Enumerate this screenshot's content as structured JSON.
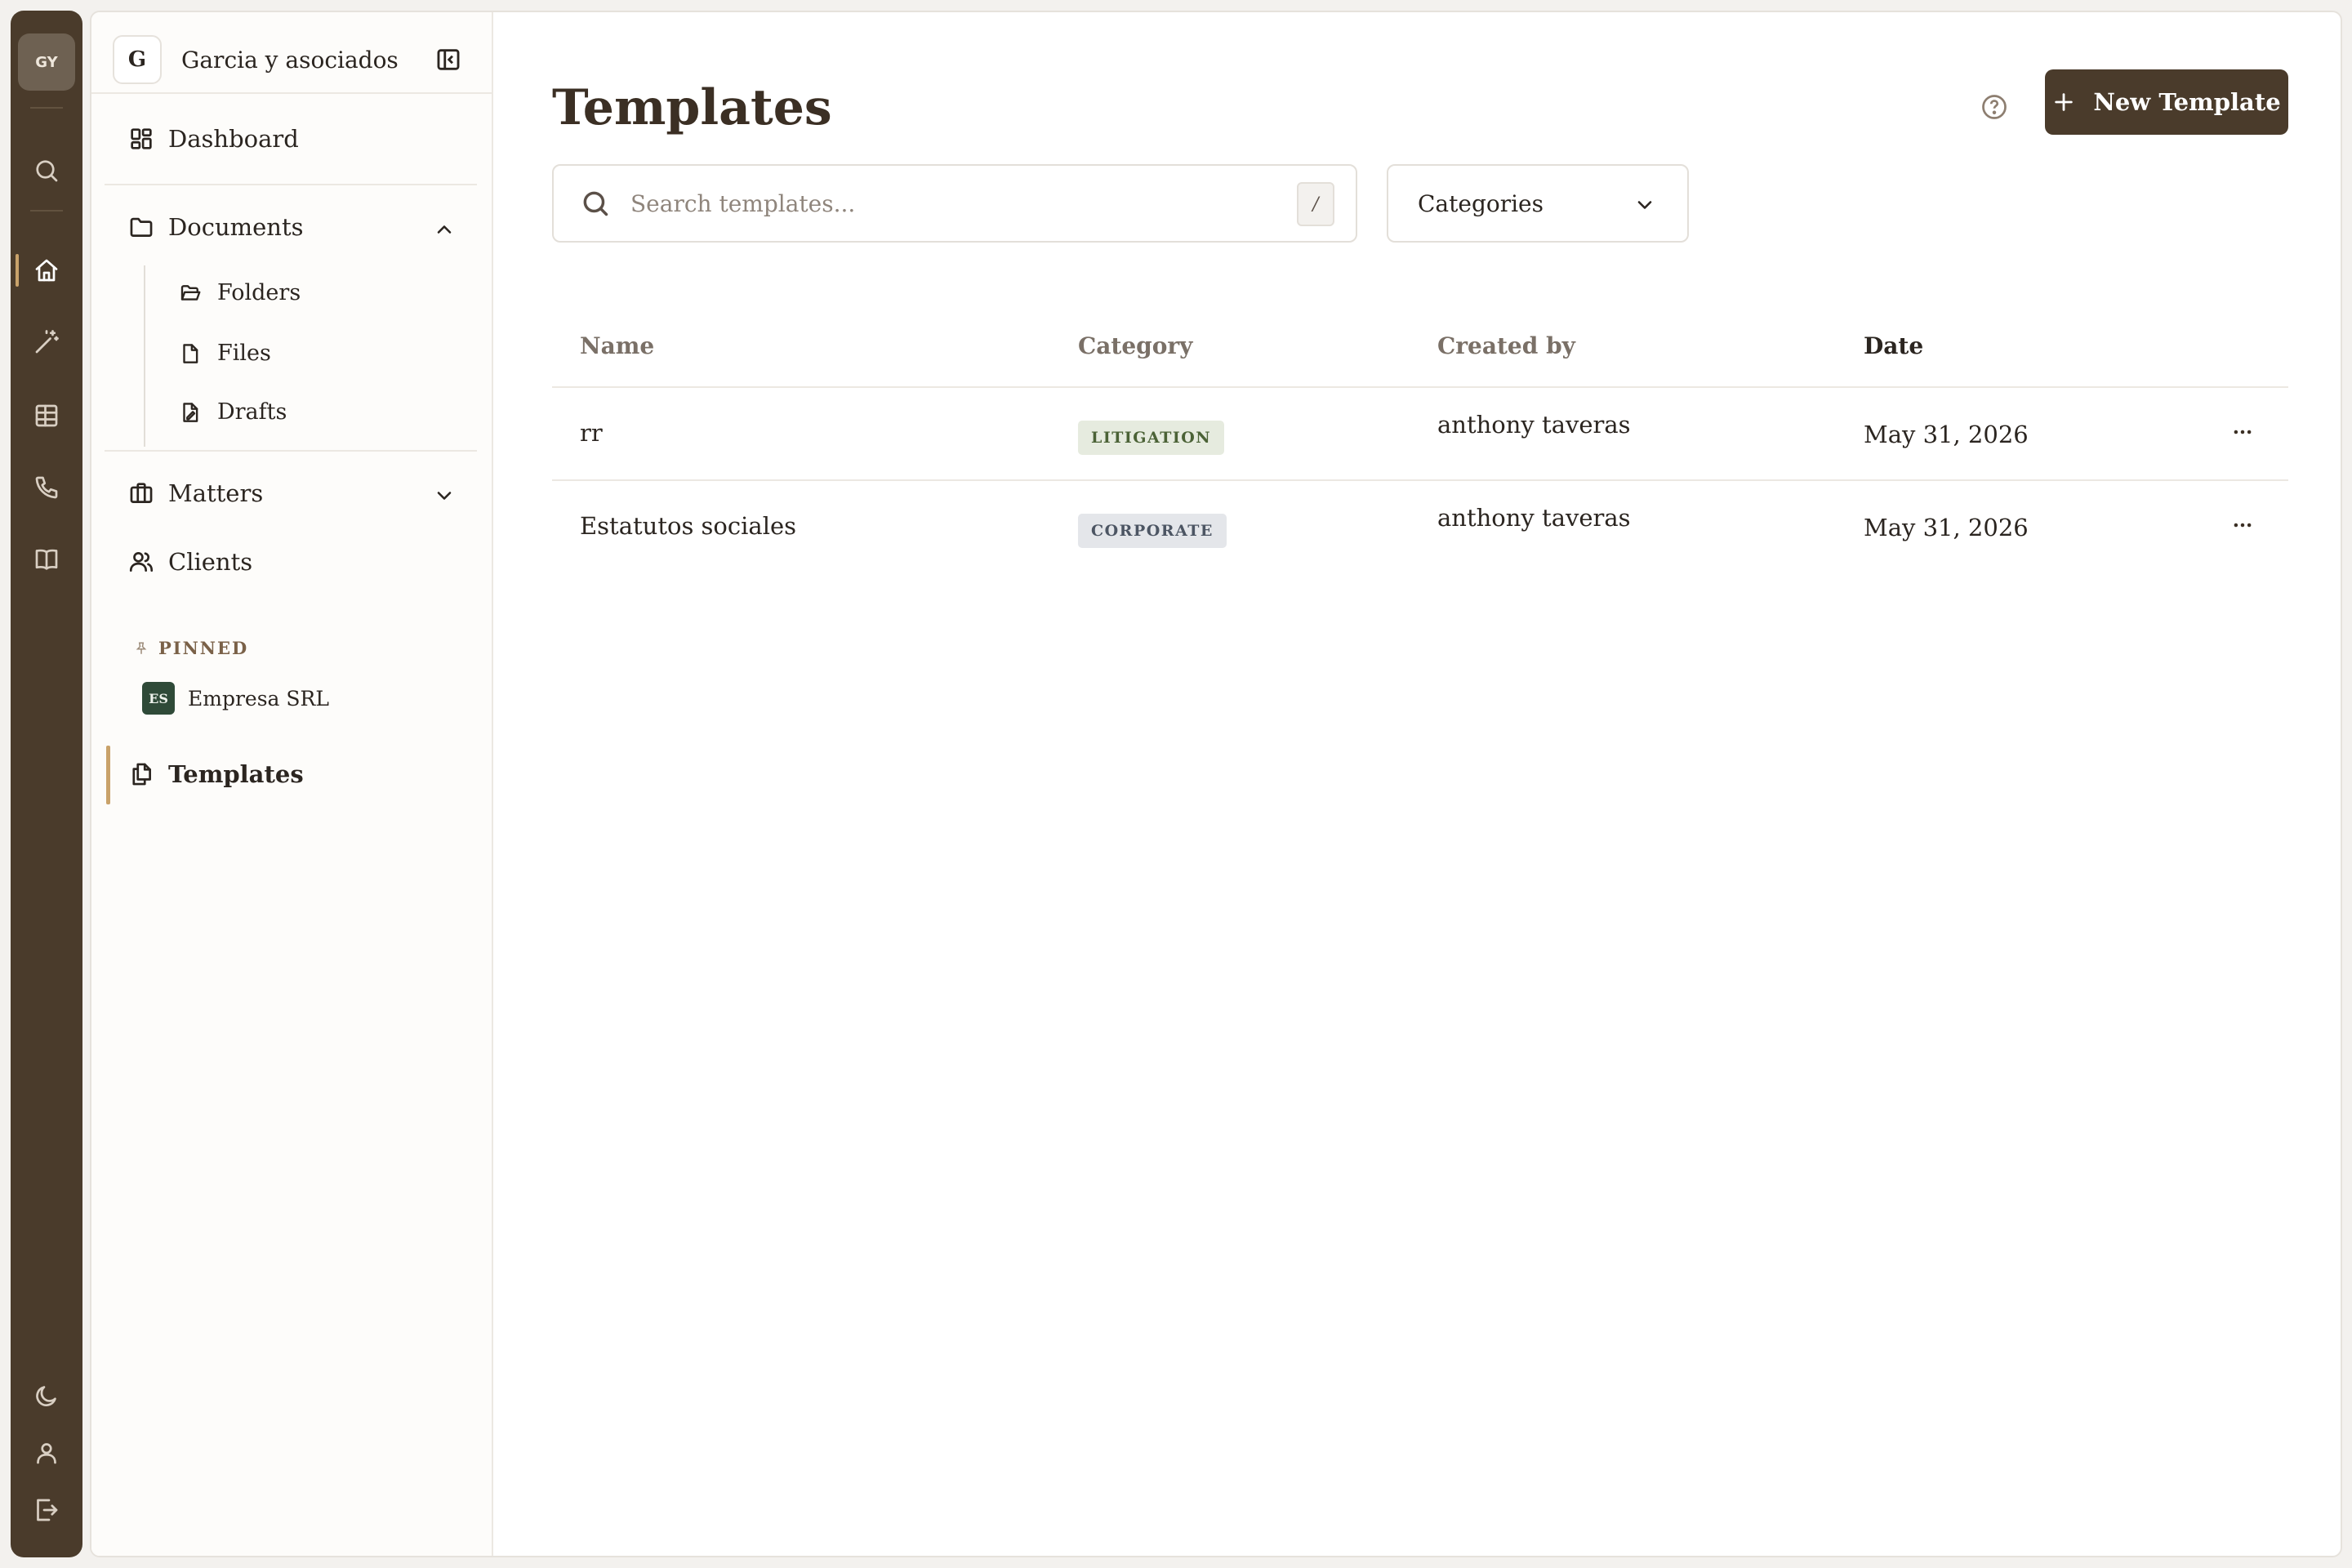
{
  "rail": {
    "avatar_initials": "GY",
    "icons_top": [
      "search-icon",
      "home-icon",
      "magic-wand-icon",
      "table-icon",
      "phone-icon",
      "book-icon"
    ],
    "icons_bottom": [
      "moon-icon",
      "user-icon",
      "logout-icon"
    ],
    "active": "home-icon"
  },
  "sidebar": {
    "org_initial": "G",
    "org_name": "Garcia y asociados",
    "dashboard_label": "Dashboard",
    "documents_label": "Documents",
    "documents_children": {
      "folders": "Folders",
      "files": "Files",
      "drafts": "Drafts"
    },
    "matters_label": "Matters",
    "clients_label": "Clients",
    "pinned_label": "PINNED",
    "pinned_item": {
      "initials": "ES",
      "label": "Empresa SRL"
    },
    "templates_label": "Templates",
    "active_item": "Templates"
  },
  "main": {
    "title": "Templates",
    "new_button_label": "New Template",
    "search_placeholder": "Search templates...",
    "search_shortcut": "/",
    "categories_label": "Categories"
  },
  "table": {
    "columns": {
      "name": "Name",
      "category": "Category",
      "created_by": "Created by",
      "date": "Date"
    },
    "rows": [
      {
        "name": "rr",
        "category": "LITIGATION",
        "created_by": "anthony taveras",
        "date": "May 31, 2026"
      },
      {
        "name": "Estatutos sociales",
        "category": "CORPORATE",
        "created_by": "anthony taveras",
        "date": "May 31, 2026"
      }
    ]
  },
  "colors": {
    "brand_dark": "#4a3b2b",
    "accent": "#c9a26a",
    "litigation_bg": "#e6ebdf",
    "corporate_bg": "#e4e6ea",
    "pinned_badge": "#2f4a38"
  }
}
